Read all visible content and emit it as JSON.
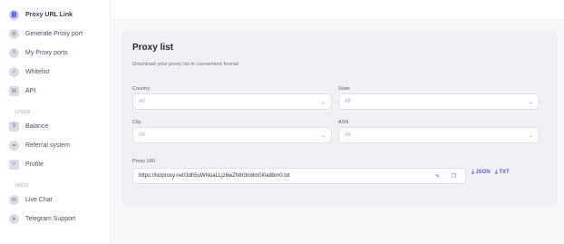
{
  "sidebar": {
    "items": [
      {
        "label": "Proxy URL Link",
        "icon": "link-icon",
        "glyph": "⛓",
        "active": true
      },
      {
        "label": "Generate Proxy port",
        "icon": "generate-icon",
        "glyph": "⚙"
      },
      {
        "label": "My Proxy ports",
        "icon": "ports-icon",
        "glyph": "≡"
      },
      {
        "label": "Whitelist",
        "icon": "whitelist-icon",
        "glyph": "✓"
      },
      {
        "label": "API",
        "icon": "api-icon",
        "glyph": "⌘"
      }
    ],
    "section_user": "USER",
    "user_items": [
      {
        "label": "Balance",
        "icon": "wallet-icon",
        "glyph": "$"
      },
      {
        "label": "Referral system",
        "icon": "referral-icon",
        "glyph": "⚭"
      },
      {
        "label": "Profile",
        "icon": "profile-icon",
        "glyph": "☺"
      }
    ],
    "section_info": "INFO",
    "info_items": [
      {
        "label": "Live Chat",
        "icon": "chat-icon",
        "glyph": "✉"
      },
      {
        "label": "Telegram Support",
        "icon": "telegram-icon",
        "glyph": "➤"
      }
    ]
  },
  "card": {
    "title": "Proxy list",
    "subtitle": "Download your proxy list in convenient format",
    "country": {
      "label": "Country",
      "placeholder": "All"
    },
    "state": {
      "label": "State",
      "placeholder": "All"
    },
    "city": {
      "label": "City",
      "placeholder": "All"
    },
    "asn": {
      "label": "ASN",
      "placeholder": "All"
    },
    "uri": {
      "label": "Proxy URI",
      "value": "https://listproxy.net/3dh5uWNoaLLjz6wZh8r0m8m0i0a8bm0.txt"
    },
    "formats": {
      "json": "JSON",
      "txt": "TXT"
    }
  },
  "colors": {
    "accent": "#5a5fd6",
    "active_icon_bg": "#c8cbf2"
  }
}
